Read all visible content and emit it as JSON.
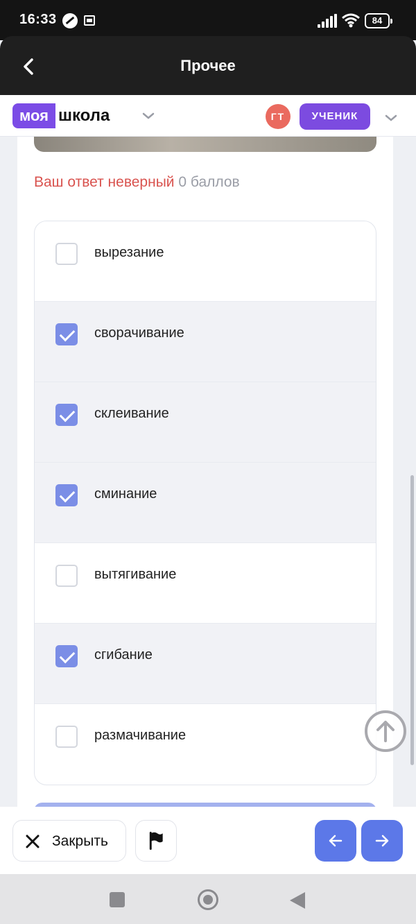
{
  "status_bar": {
    "time": "16:33",
    "battery": "84"
  },
  "header": {
    "title": "Прочее"
  },
  "brand": {
    "logo_part1": "моя",
    "logo_part2": "школа",
    "avatar_initials": "ГТ",
    "role": "УЧЕНИК"
  },
  "result": {
    "status_text": "Ваш ответ неверный",
    "points_text": "0 баллов"
  },
  "options": [
    {
      "label": "вырезание",
      "checked": false
    },
    {
      "label": "сворачивание",
      "checked": true
    },
    {
      "label": "склеивание",
      "checked": true
    },
    {
      "label": "сминание",
      "checked": true
    },
    {
      "label": "вытягивание",
      "checked": false
    },
    {
      "label": "сгибание",
      "checked": true
    },
    {
      "label": "размачивание",
      "checked": false
    }
  ],
  "toolbar": {
    "close_label": "Закрыть"
  },
  "colors": {
    "accent": "#5c78e8",
    "brand": "#7b4ce6",
    "error": "#d9534f",
    "checkbox_checked": "#7b8ee6"
  },
  "icons": [
    "back-arrow-icon",
    "chevron-down-icon",
    "arrow-up-icon",
    "close-icon",
    "flag-icon",
    "arrow-left-icon",
    "arrow-right-icon"
  ]
}
